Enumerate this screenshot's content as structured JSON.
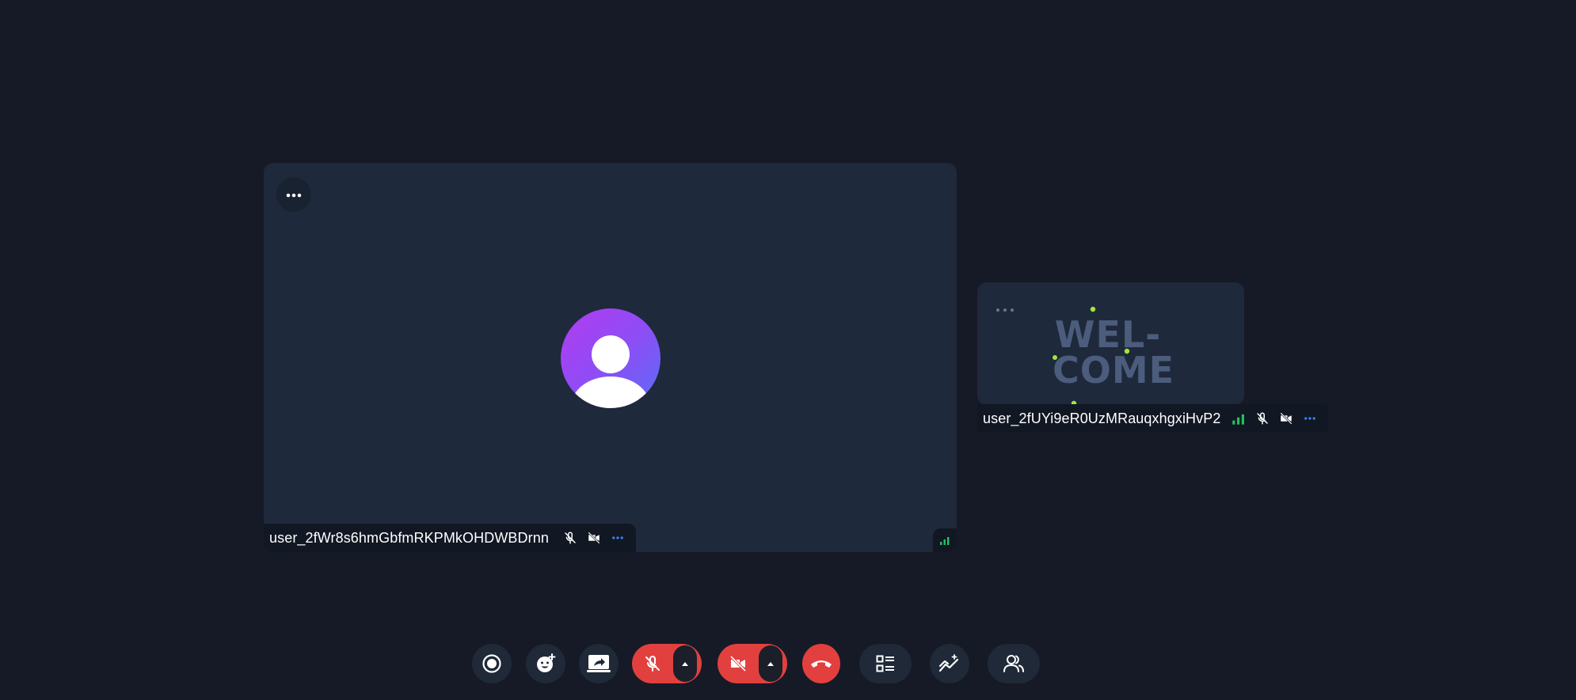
{
  "colors": {
    "background": "#161a26",
    "tile": "#1e293b",
    "danger": "#e2403e",
    "accent_blue": "#3b82f6",
    "signal_green": "#22c55e",
    "confetti": "#a3e635"
  },
  "main_tile": {
    "participant_name": "user_2fWr8s6hmGbfmRKPMkOHDWBDrnn",
    "mic": "muted",
    "camera": "off",
    "avatar_icon": "user-icon",
    "more_icon": "more-horizontal-icon"
  },
  "side_tile": {
    "participant_name": "user_2fUYi9eR0UzMRauqxhgxiHvP2",
    "welcome_line1": "WEL-",
    "welcome_line2": "COME",
    "mic": "muted",
    "camera": "off"
  },
  "controls": [
    {
      "name": "record",
      "icon": "record-icon"
    },
    {
      "name": "reactions",
      "icon": "emoji-add-icon"
    },
    {
      "name": "screen-share",
      "icon": "screen-share-icon"
    },
    {
      "name": "microphone",
      "icon": "mic-off-icon",
      "state": "muted"
    },
    {
      "name": "camera",
      "icon": "video-off-icon",
      "state": "off"
    },
    {
      "name": "leave-call",
      "icon": "phone-hangup-icon"
    },
    {
      "name": "layout",
      "icon": "layout-list-icon"
    },
    {
      "name": "stats",
      "icon": "chart-sparkle-icon"
    },
    {
      "name": "participants",
      "icon": "users-icon"
    }
  ]
}
